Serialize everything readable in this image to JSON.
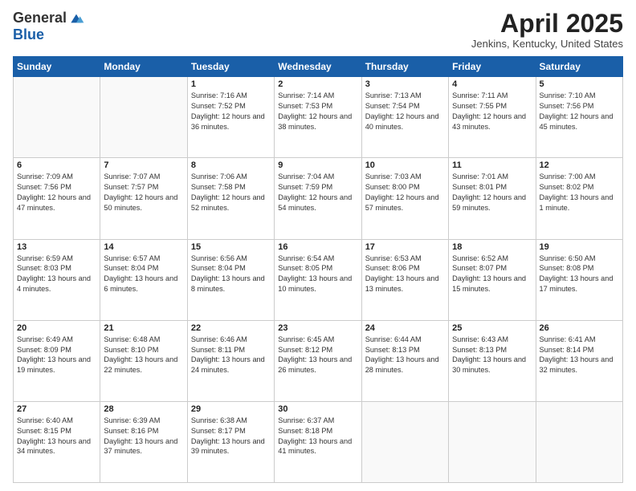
{
  "header": {
    "logo_general": "General",
    "logo_blue": "Blue",
    "title": "April 2025",
    "location": "Jenkins, Kentucky, United States"
  },
  "days_of_week": [
    "Sunday",
    "Monday",
    "Tuesday",
    "Wednesday",
    "Thursday",
    "Friday",
    "Saturday"
  ],
  "weeks": [
    [
      {
        "day": "",
        "empty": true
      },
      {
        "day": "",
        "empty": true
      },
      {
        "day": "1",
        "sunrise": "Sunrise: 7:16 AM",
        "sunset": "Sunset: 7:52 PM",
        "daylight": "Daylight: 12 hours and 36 minutes."
      },
      {
        "day": "2",
        "sunrise": "Sunrise: 7:14 AM",
        "sunset": "Sunset: 7:53 PM",
        "daylight": "Daylight: 12 hours and 38 minutes."
      },
      {
        "day": "3",
        "sunrise": "Sunrise: 7:13 AM",
        "sunset": "Sunset: 7:54 PM",
        "daylight": "Daylight: 12 hours and 40 minutes."
      },
      {
        "day": "4",
        "sunrise": "Sunrise: 7:11 AM",
        "sunset": "Sunset: 7:55 PM",
        "daylight": "Daylight: 12 hours and 43 minutes."
      },
      {
        "day": "5",
        "sunrise": "Sunrise: 7:10 AM",
        "sunset": "Sunset: 7:56 PM",
        "daylight": "Daylight: 12 hours and 45 minutes."
      }
    ],
    [
      {
        "day": "6",
        "sunrise": "Sunrise: 7:09 AM",
        "sunset": "Sunset: 7:56 PM",
        "daylight": "Daylight: 12 hours and 47 minutes."
      },
      {
        "day": "7",
        "sunrise": "Sunrise: 7:07 AM",
        "sunset": "Sunset: 7:57 PM",
        "daylight": "Daylight: 12 hours and 50 minutes."
      },
      {
        "day": "8",
        "sunrise": "Sunrise: 7:06 AM",
        "sunset": "Sunset: 7:58 PM",
        "daylight": "Daylight: 12 hours and 52 minutes."
      },
      {
        "day": "9",
        "sunrise": "Sunrise: 7:04 AM",
        "sunset": "Sunset: 7:59 PM",
        "daylight": "Daylight: 12 hours and 54 minutes."
      },
      {
        "day": "10",
        "sunrise": "Sunrise: 7:03 AM",
        "sunset": "Sunset: 8:00 PM",
        "daylight": "Daylight: 12 hours and 57 minutes."
      },
      {
        "day": "11",
        "sunrise": "Sunrise: 7:01 AM",
        "sunset": "Sunset: 8:01 PM",
        "daylight": "Daylight: 12 hours and 59 minutes."
      },
      {
        "day": "12",
        "sunrise": "Sunrise: 7:00 AM",
        "sunset": "Sunset: 8:02 PM",
        "daylight": "Daylight: 13 hours and 1 minute."
      }
    ],
    [
      {
        "day": "13",
        "sunrise": "Sunrise: 6:59 AM",
        "sunset": "Sunset: 8:03 PM",
        "daylight": "Daylight: 13 hours and 4 minutes."
      },
      {
        "day": "14",
        "sunrise": "Sunrise: 6:57 AM",
        "sunset": "Sunset: 8:04 PM",
        "daylight": "Daylight: 13 hours and 6 minutes."
      },
      {
        "day": "15",
        "sunrise": "Sunrise: 6:56 AM",
        "sunset": "Sunset: 8:04 PM",
        "daylight": "Daylight: 13 hours and 8 minutes."
      },
      {
        "day": "16",
        "sunrise": "Sunrise: 6:54 AM",
        "sunset": "Sunset: 8:05 PM",
        "daylight": "Daylight: 13 hours and 10 minutes."
      },
      {
        "day": "17",
        "sunrise": "Sunrise: 6:53 AM",
        "sunset": "Sunset: 8:06 PM",
        "daylight": "Daylight: 13 hours and 13 minutes."
      },
      {
        "day": "18",
        "sunrise": "Sunrise: 6:52 AM",
        "sunset": "Sunset: 8:07 PM",
        "daylight": "Daylight: 13 hours and 15 minutes."
      },
      {
        "day": "19",
        "sunrise": "Sunrise: 6:50 AM",
        "sunset": "Sunset: 8:08 PM",
        "daylight": "Daylight: 13 hours and 17 minutes."
      }
    ],
    [
      {
        "day": "20",
        "sunrise": "Sunrise: 6:49 AM",
        "sunset": "Sunset: 8:09 PM",
        "daylight": "Daylight: 13 hours and 19 minutes."
      },
      {
        "day": "21",
        "sunrise": "Sunrise: 6:48 AM",
        "sunset": "Sunset: 8:10 PM",
        "daylight": "Daylight: 13 hours and 22 minutes."
      },
      {
        "day": "22",
        "sunrise": "Sunrise: 6:46 AM",
        "sunset": "Sunset: 8:11 PM",
        "daylight": "Daylight: 13 hours and 24 minutes."
      },
      {
        "day": "23",
        "sunrise": "Sunrise: 6:45 AM",
        "sunset": "Sunset: 8:12 PM",
        "daylight": "Daylight: 13 hours and 26 minutes."
      },
      {
        "day": "24",
        "sunrise": "Sunrise: 6:44 AM",
        "sunset": "Sunset: 8:13 PM",
        "daylight": "Daylight: 13 hours and 28 minutes."
      },
      {
        "day": "25",
        "sunrise": "Sunrise: 6:43 AM",
        "sunset": "Sunset: 8:13 PM",
        "daylight": "Daylight: 13 hours and 30 minutes."
      },
      {
        "day": "26",
        "sunrise": "Sunrise: 6:41 AM",
        "sunset": "Sunset: 8:14 PM",
        "daylight": "Daylight: 13 hours and 32 minutes."
      }
    ],
    [
      {
        "day": "27",
        "sunrise": "Sunrise: 6:40 AM",
        "sunset": "Sunset: 8:15 PM",
        "daylight": "Daylight: 13 hours and 34 minutes."
      },
      {
        "day": "28",
        "sunrise": "Sunrise: 6:39 AM",
        "sunset": "Sunset: 8:16 PM",
        "daylight": "Daylight: 13 hours and 37 minutes."
      },
      {
        "day": "29",
        "sunrise": "Sunrise: 6:38 AM",
        "sunset": "Sunset: 8:17 PM",
        "daylight": "Daylight: 13 hours and 39 minutes."
      },
      {
        "day": "30",
        "sunrise": "Sunrise: 6:37 AM",
        "sunset": "Sunset: 8:18 PM",
        "daylight": "Daylight: 13 hours and 41 minutes."
      },
      {
        "day": "",
        "empty": true
      },
      {
        "day": "",
        "empty": true
      },
      {
        "day": "",
        "empty": true
      }
    ]
  ]
}
